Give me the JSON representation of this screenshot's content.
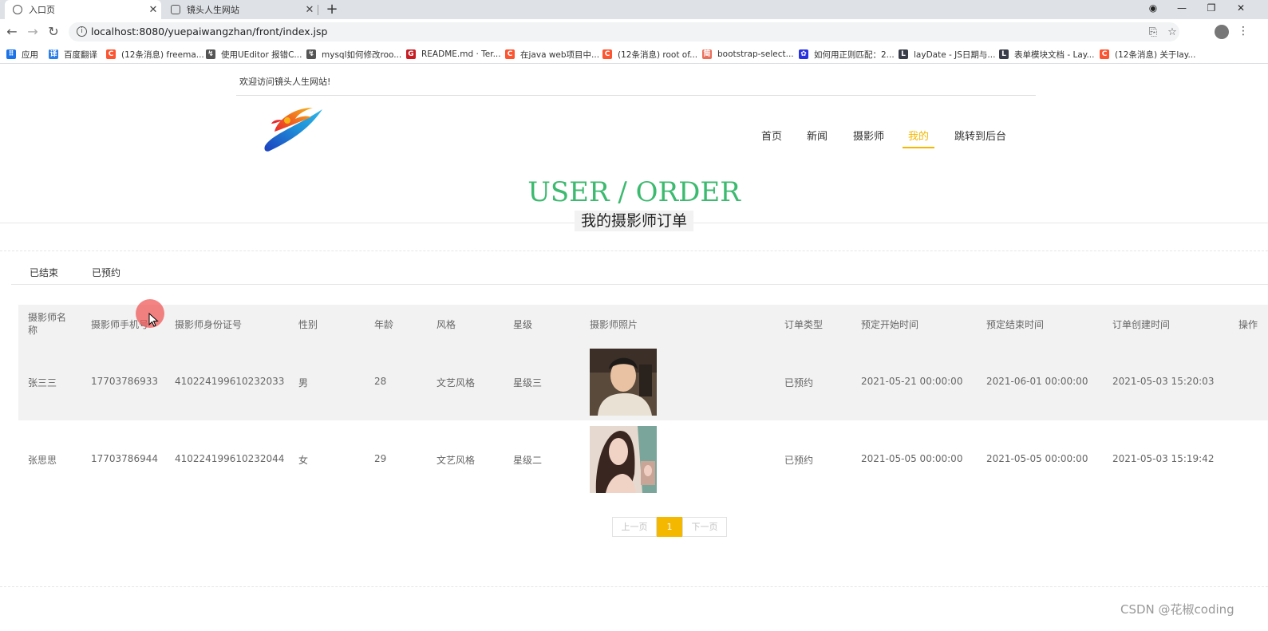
{
  "browser": {
    "tabs": [
      {
        "title": "入口页",
        "active": true
      },
      {
        "title": "镜头人生网站",
        "active": false
      }
    ],
    "url": "localhost:8080/yuepaiwangzhan/front/index.jsp",
    "bookmarks": [
      {
        "label": "应用",
        "icon": "apps-grid-icon",
        "color": "#1a73e8"
      },
      {
        "label": "百度翻译",
        "icon": "baidu-translate-icon",
        "color": "#2b7de9"
      },
      {
        "label": "(12条消息) freema...",
        "icon": "csdn-icon",
        "color": "#fc5531"
      },
      {
        "label": "使用UEditor 报错C...",
        "icon": "link-icon",
        "color": "#555555"
      },
      {
        "label": "mysql如何修改roo...",
        "icon": "link-icon",
        "color": "#555555"
      },
      {
        "label": "README.md · Ter...",
        "icon": "gitee-icon",
        "color": "#c71d23"
      },
      {
        "label": "在java web项目中...",
        "icon": "csdn-icon",
        "color": "#fc5531"
      },
      {
        "label": "(12条消息) root of...",
        "icon": "csdn-icon",
        "color": "#fc5531"
      },
      {
        "label": "bootstrap-select...",
        "icon": "jianshu-icon",
        "color": "#ea6f5a"
      },
      {
        "label": "如何用正则匹配：2...",
        "icon": "baidu-paw-icon",
        "color": "#2932e1"
      },
      {
        "label": "layDate - JS日期与...",
        "icon": "layui-icon",
        "color": "#393d49"
      },
      {
        "label": "表单模块文档 - Lay...",
        "icon": "layui-icon",
        "color": "#393d49"
      },
      {
        "label": "(12条消息) 关于lay...",
        "icon": "csdn-icon",
        "color": "#fc5531"
      }
    ]
  },
  "site": {
    "welcome": "欢迎访问镜头人生网站!",
    "nav": [
      {
        "label": "首页",
        "active": false
      },
      {
        "label": "新闻",
        "active": false
      },
      {
        "label": "摄影师",
        "active": false
      },
      {
        "label": "我的",
        "active": true
      },
      {
        "label": "跳转到后台",
        "active": false
      }
    ],
    "accent_color": "#f5b800",
    "headline": "USER / ORDER",
    "headline_color": "#3cba6f",
    "subtitle": "我的摄影师订单"
  },
  "subtabs": [
    "已结束",
    "已预约"
  ],
  "table": {
    "headers": [
      "摄影师名称",
      "摄影师手机号",
      "摄影师身份证号",
      "性别",
      "年龄",
      "风格",
      "星级",
      "摄影师照片",
      "订单类型",
      "预定开始时间",
      "预定结束时间",
      "订单创建时间",
      "操作"
    ],
    "rows": [
      [
        "张三三",
        "17703786933",
        "410224199610232033",
        "男",
        "28",
        "文艺风格",
        "星级三",
        "",
        "已预约",
        "2021-05-21 00:00:00",
        "2021-06-01 00:00:00",
        "2021-05-03 15:20:03"
      ],
      [
        "张思思",
        "17703786944",
        "410224199610232044",
        "女",
        "29",
        "文艺风格",
        "星级二",
        "",
        "已预约",
        "2021-05-05 00:00:00",
        "2021-05-05 00:00:00",
        "2021-05-03 15:19:42"
      ]
    ]
  },
  "pager": {
    "prev": "上一页",
    "current": "1",
    "next": "下一页"
  },
  "watermark": "CSDN @花椒coding"
}
